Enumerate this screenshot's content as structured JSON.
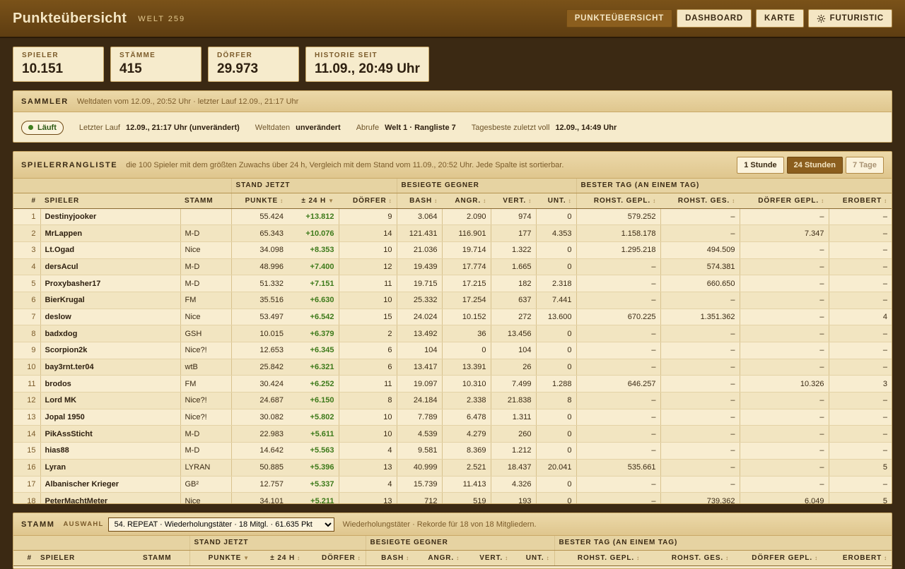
{
  "header": {
    "title": "Punkteübersicht",
    "world": "WELT 259",
    "nav": [
      "PUNKTEÜBERSICHT",
      "DASHBOARD",
      "KARTE",
      "FUTURISTIC"
    ]
  },
  "stats": [
    {
      "label": "SPIELER",
      "value": "10.151"
    },
    {
      "label": "STÄMME",
      "value": "415"
    },
    {
      "label": "DÖRFER",
      "value": "29.973"
    },
    {
      "label": "HISTORIE SEIT",
      "value": "11.09., 20:49 Uhr"
    }
  ],
  "sammler": {
    "title": "SAMMLER",
    "sub": "Weltdaten vom 12.09., 20:52 Uhr · letzter Lauf 12.09., 21:17 Uhr",
    "status": "Läuft",
    "k1": "Letzter Lauf",
    "v1": "12.09., 21:17 Uhr (unverändert)",
    "k2": "Weltdaten",
    "v2": "unverändert",
    "k3": "Abrufe",
    "v3": "Welt 1 · Rangliste 7",
    "k4": "Tagesbeste zuletzt voll",
    "v4": "12.09., 14:49 Uhr"
  },
  "ranking": {
    "title": "SPIELERRANGLISTE",
    "sub": "die 100 Spieler mit dem größten Zuwachs über 24 h, Vergleich mit dem Stand vom 11.09., 20:52 Uhr. Jede Spalte ist sortierbar.",
    "tabs": [
      "1 Stunde",
      "24 Stunden",
      "7 Tage"
    ],
    "groups": [
      "STAND JETZT",
      "BESIEGTE GEGNER",
      "BESTER TAG (AN EINEM TAG)"
    ],
    "columns": [
      "#",
      "SPIELER",
      "STAMM",
      "PUNKTE",
      "± 24 H",
      "DÖRFER",
      "BASH",
      "ANGR.",
      "VERT.",
      "UNT.",
      "ROHST. GEPL.",
      "ROHST. GES.",
      "DÖRFER GEPL.",
      "EROBERT"
    ],
    "rows": [
      [
        "1",
        "Destinyjooker",
        "",
        "55.424",
        "+13.812",
        "9",
        "3.064",
        "2.090",
        "974",
        "0",
        "579.252",
        "–",
        "–",
        "–"
      ],
      [
        "2",
        "MrLappen",
        "M-D",
        "65.343",
        "+10.076",
        "14",
        "121.431",
        "116.901",
        "177",
        "4.353",
        "1.158.178",
        "–",
        "7.347",
        "–"
      ],
      [
        "3",
        "Lt.Ogad",
        "Nice",
        "34.098",
        "+8.353",
        "10",
        "21.036",
        "19.714",
        "1.322",
        "0",
        "1.295.218",
        "494.509",
        "–",
        "–"
      ],
      [
        "4",
        "dersAcul",
        "M-D",
        "48.996",
        "+7.400",
        "12",
        "19.439",
        "17.774",
        "1.665",
        "0",
        "–",
        "574.381",
        "–",
        "–"
      ],
      [
        "5",
        "Proxybasher17",
        "M-D",
        "51.332",
        "+7.151",
        "11",
        "19.715",
        "17.215",
        "182",
        "2.318",
        "–",
        "660.650",
        "–",
        "–"
      ],
      [
        "6",
        "BierKrugal",
        "FM",
        "35.516",
        "+6.630",
        "10",
        "25.332",
        "17.254",
        "637",
        "7.441",
        "–",
        "–",
        "–",
        "–"
      ],
      [
        "7",
        "deslow",
        "Nice",
        "53.497",
        "+6.542",
        "15",
        "24.024",
        "10.152",
        "272",
        "13.600",
        "670.225",
        "1.351.362",
        "–",
        "4"
      ],
      [
        "8",
        "badxdog",
        "GSH",
        "10.015",
        "+6.379",
        "2",
        "13.492",
        "36",
        "13.456",
        "0",
        "–",
        "–",
        "–",
        "–"
      ],
      [
        "9",
        "Scorpion2k",
        "Nice?!",
        "12.653",
        "+6.345",
        "6",
        "104",
        "0",
        "104",
        "0",
        "–",
        "–",
        "–",
        "–"
      ],
      [
        "10",
        "bay3rnt.ter04",
        "wtB",
        "25.842",
        "+6.321",
        "6",
        "13.417",
        "13.391",
        "26",
        "0",
        "–",
        "–",
        "–",
        "–"
      ],
      [
        "11",
        "brodos",
        "FM",
        "30.424",
        "+6.252",
        "11",
        "19.097",
        "10.310",
        "7.499",
        "1.288",
        "646.257",
        "–",
        "10.326",
        "3"
      ],
      [
        "12",
        "Lord MK",
        "Nice?!",
        "24.687",
        "+6.150",
        "8",
        "24.184",
        "2.338",
        "21.838",
        "8",
        "–",
        "–",
        "–",
        "–"
      ],
      [
        "13",
        "Jopal 1950",
        "Nice?!",
        "30.082",
        "+5.802",
        "10",
        "7.789",
        "6.478",
        "1.311",
        "0",
        "–",
        "–",
        "–",
        "–"
      ],
      [
        "14",
        "PikAssSticht",
        "M-D",
        "22.983",
        "+5.611",
        "10",
        "4.539",
        "4.279",
        "260",
        "0",
        "–",
        "–",
        "–",
        "–"
      ],
      [
        "15",
        "hias88",
        "M-D",
        "14.642",
        "+5.563",
        "4",
        "9.581",
        "8.369",
        "1.212",
        "0",
        "–",
        "–",
        "–",
        "–"
      ],
      [
        "16",
        "Lyran",
        "LYRAN",
        "50.885",
        "+5.396",
        "13",
        "40.999",
        "2.521",
        "18.437",
        "20.041",
        "535.661",
        "–",
        "–",
        "5"
      ],
      [
        "17",
        "Albanischer Krieger",
        "GB²",
        "12.757",
        "+5.337",
        "4",
        "15.739",
        "11.413",
        "4.326",
        "0",
        "–",
        "–",
        "–",
        "–"
      ],
      [
        "18",
        "PeterMachtMeter",
        "Nice",
        "34.101",
        "+5.211",
        "13",
        "712",
        "519",
        "193",
        "0",
        "–",
        "739.362",
        "6.049",
        "5"
      ]
    ]
  },
  "stamm": {
    "title": "STAMM",
    "auswahl": "AUSWAHL",
    "selected": "54. REPEAT · Wiederholungstäter · 18 Mitgl. · 61.635 Pkt",
    "sub": "Wiederholungstäter · Rekorde für 18 von 18 Mitgliedern.",
    "groups": [
      "STAND JETZT",
      "BESIEGTE GEGNER",
      "BESTER TAG (AN EINEM TAG)"
    ],
    "columns": [
      "#",
      "SPIELER",
      "STAMM",
      "PUNKTE",
      "± 24 H",
      "DÖRFER",
      "BASH",
      "ANGR.",
      "VERT.",
      "UNT.",
      "ROHST. GEPL.",
      "ROHST. GES.",
      "DÖRFER GEPL.",
      "EROBERT"
    ]
  }
}
